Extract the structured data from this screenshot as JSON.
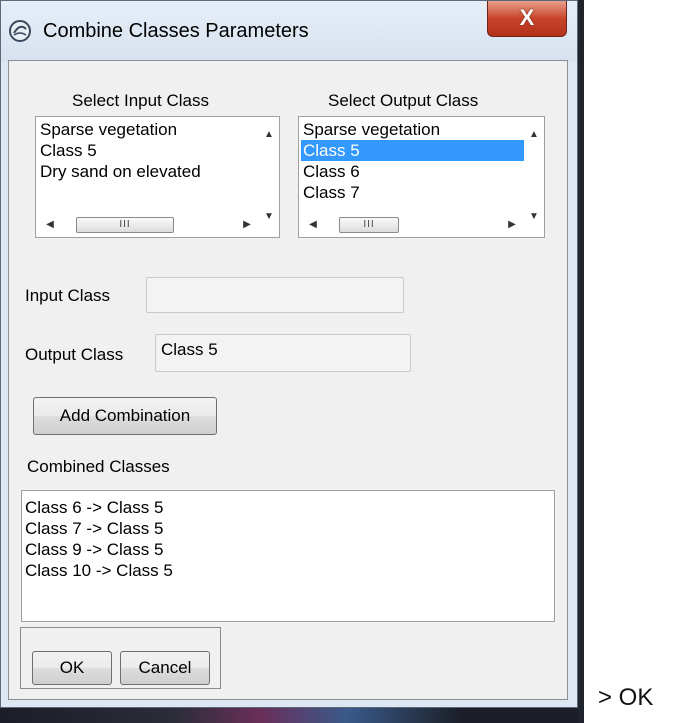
{
  "window": {
    "title": "Combine Classes Parameters",
    "close_glyph": "X",
    "icon": "app-icon"
  },
  "input_class_list": {
    "label": "Select Input Class",
    "items": [
      "Sparse vegetation",
      "Class 5",
      "Dry sand on elevated"
    ],
    "selected": null
  },
  "output_class_list": {
    "label": "Select Output Class",
    "items": [
      "Sparse vegetation",
      "Class 5",
      "Class 6",
      "Class 7"
    ],
    "selected": "Class 5"
  },
  "fields": {
    "input_class_label": "Input Class",
    "input_class_value": "",
    "output_class_label": "Output Class",
    "output_class_value": "Class 5"
  },
  "buttons": {
    "add_combination": "Add Combination",
    "ok": "OK",
    "cancel": "Cancel"
  },
  "combined": {
    "label": "Combined Classes",
    "items": [
      "Class 6 -> Class 5",
      "Class 7 -> Class 5",
      "Class 9 -> Class 5",
      "Class 10 -> Class 5"
    ]
  },
  "annotation": "> OK",
  "colors": {
    "selection": "#3399ff",
    "close_button": "#c8442b"
  }
}
